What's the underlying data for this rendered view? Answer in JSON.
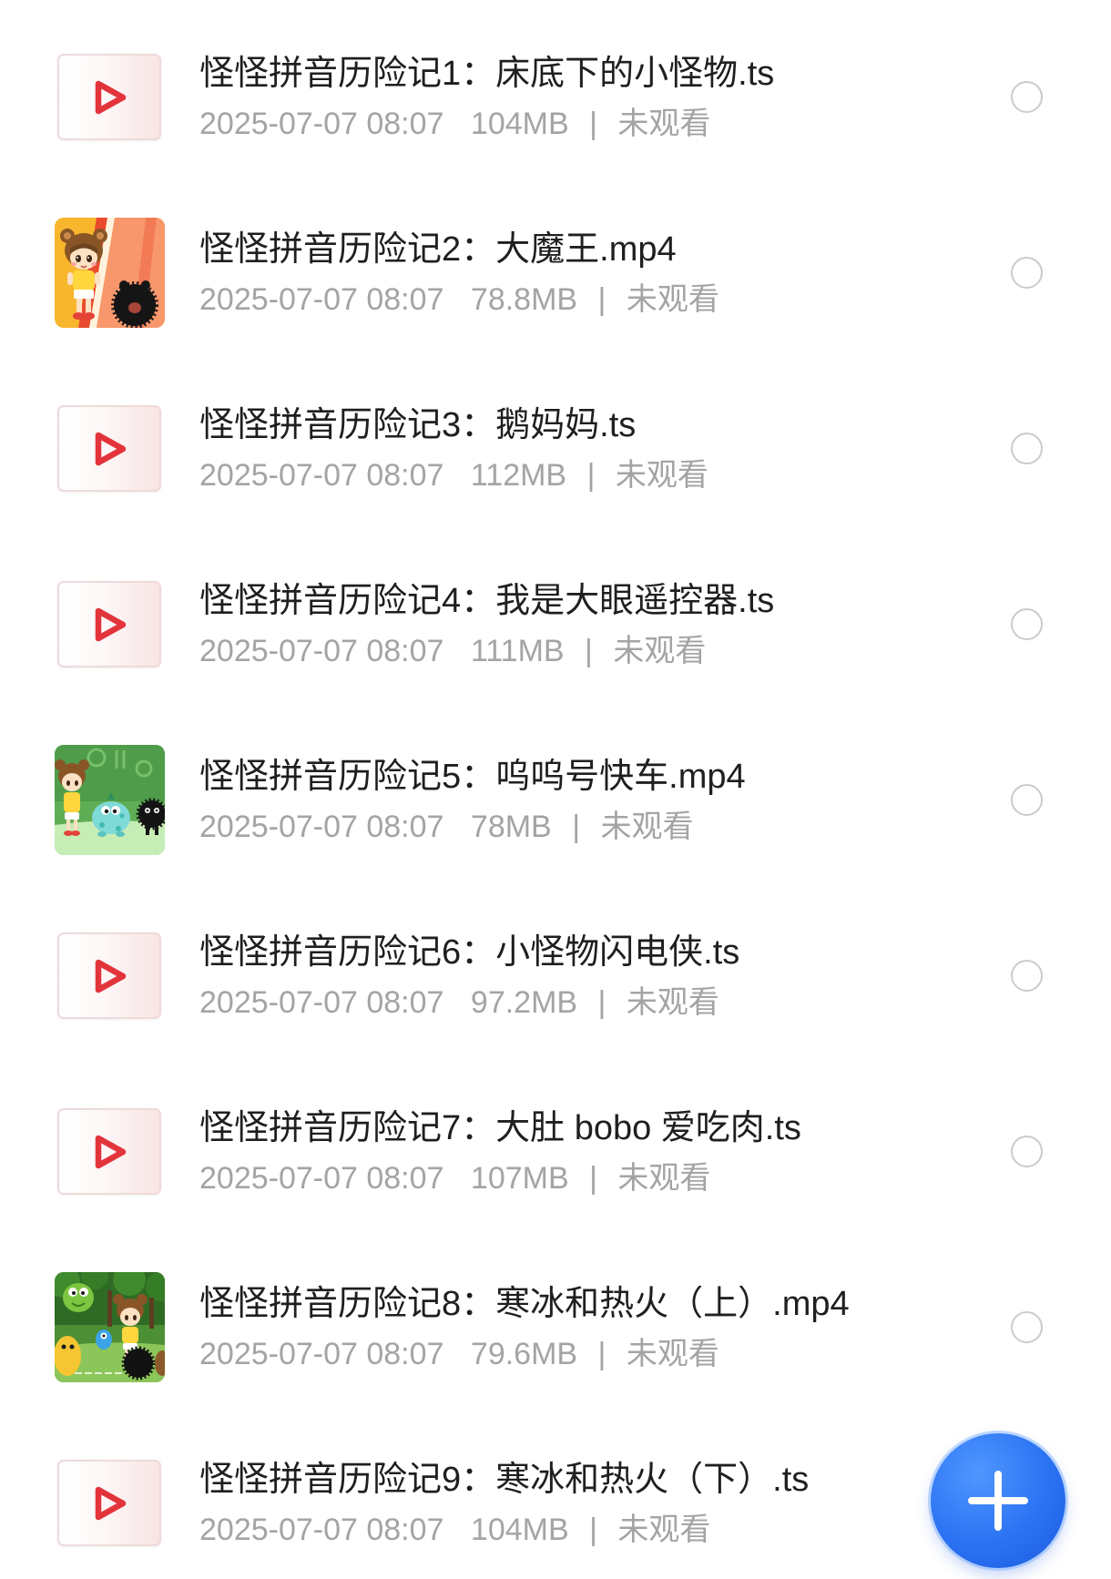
{
  "colors": {
    "accent": "#2b72f3",
    "play-icon": "#e3343b",
    "title-text": "#1f1f1f",
    "meta-text": "#a4a4a4",
    "radio-border": "#cbcbcb"
  },
  "list": {
    "separator": "|",
    "items": [
      {
        "title": "怪怪拼音历险记1：床底下的小怪物.ts",
        "date": "2025-07-07 08:07",
        "size": "104MB",
        "status": "未观看",
        "thumbnail": "play-icon",
        "selected": false
      },
      {
        "title": "怪怪拼音历险记2：大魔王.mp4",
        "date": "2025-07-07 08:07",
        "size": "78.8MB",
        "status": "未观看",
        "thumbnail": "image",
        "selected": false
      },
      {
        "title": "怪怪拼音历险记3：鹅妈妈.ts",
        "date": "2025-07-07 08:07",
        "size": "112MB",
        "status": "未观看",
        "thumbnail": "play-icon",
        "selected": false
      },
      {
        "title": "怪怪拼音历险记4：我是大眼遥控器.ts",
        "date": "2025-07-07 08:07",
        "size": "111MB",
        "status": "未观看",
        "thumbnail": "play-icon",
        "selected": false
      },
      {
        "title": "怪怪拼音历险记5：呜呜号快车.mp4",
        "date": "2025-07-07 08:07",
        "size": "78MB",
        "status": "未观看",
        "thumbnail": "image",
        "selected": false
      },
      {
        "title": "怪怪拼音历险记6：小怪物闪电侠.ts",
        "date": "2025-07-07 08:07",
        "size": "97.2MB",
        "status": "未观看",
        "thumbnail": "play-icon",
        "selected": false
      },
      {
        "title": "怪怪拼音历险记7：大肚 bobo 爱吃肉.ts",
        "date": "2025-07-07 08:07",
        "size": "107MB",
        "status": "未观看",
        "thumbnail": "play-icon",
        "selected": false
      },
      {
        "title": "怪怪拼音历险记8：寒冰和热火（上）.mp4",
        "date": "2025-07-07 08:07",
        "size": "79.6MB",
        "status": "未观看",
        "thumbnail": "image",
        "selected": false
      },
      {
        "title": "怪怪拼音历险记9：寒冰和热火（下）.ts",
        "date": "2025-07-07 08:07",
        "size": "104MB",
        "status": "未观看",
        "thumbnail": "play-icon",
        "selected": false
      }
    ]
  },
  "fab": {
    "icon": "plus-icon"
  }
}
